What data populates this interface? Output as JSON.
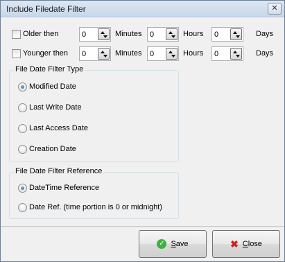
{
  "window": {
    "title": "Include Filedate Filter",
    "close_glyph": "✕"
  },
  "filters": [
    {
      "label": "Older then",
      "minutes": "0",
      "hours": "0",
      "days": "0",
      "checked": false
    },
    {
      "label": "Younger then",
      "minutes": "0",
      "hours": "0",
      "days": "0",
      "checked": false
    }
  ],
  "units": {
    "minutes": "Minutes",
    "hours": "Hours",
    "days": "Days"
  },
  "spin_glyph": "spin-updown-icon",
  "type_group": {
    "title": "File Date Filter Type",
    "options": [
      "Modified Date",
      "Last Write Date",
      "Last Access Date",
      "Creation Date"
    ],
    "selected": "Modified Date"
  },
  "ref_group": {
    "title": "File Date Filter Reference",
    "options": [
      "DateTime Reference",
      "Date Ref. (time portion is 0 or midnight)"
    ],
    "selected": "DateTime Reference"
  },
  "buttons": {
    "save": {
      "accel": "S",
      "rest": "ave",
      "icon": "check-icon"
    },
    "close": {
      "accel": "C",
      "rest": "lose",
      "icon": "close-x-icon"
    }
  }
}
